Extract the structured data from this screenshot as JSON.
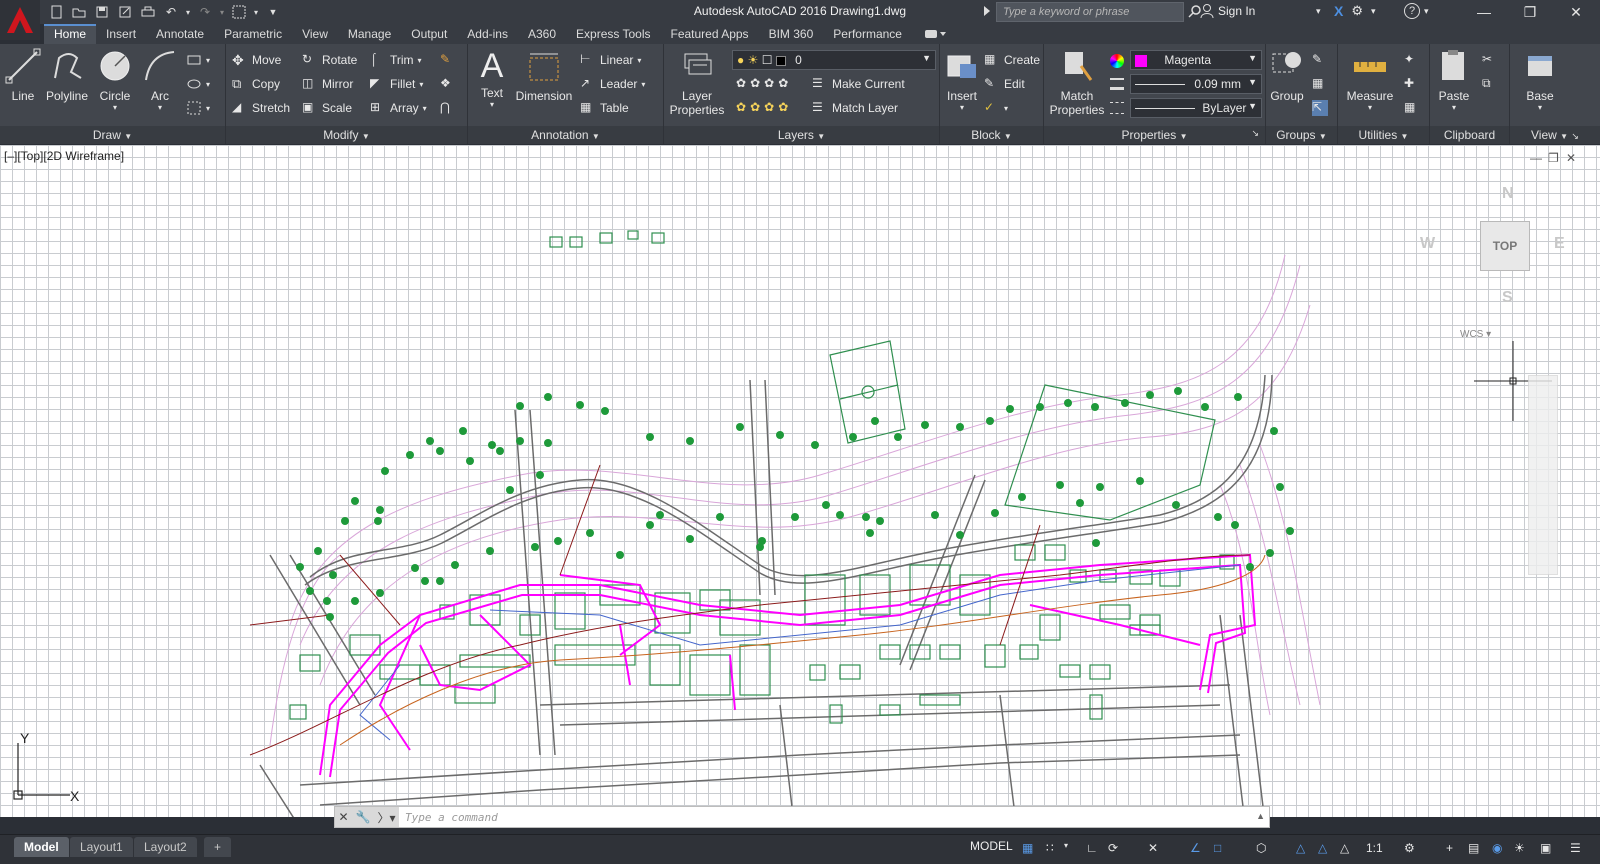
{
  "window": {
    "title": "Autodesk AutoCAD 2016    Drawing1.dwg",
    "search_placeholder": "Type a keyword or phrase",
    "sign_in": "Sign In"
  },
  "ribbon_tabs": [
    "Home",
    "Insert",
    "Annotate",
    "Parametric",
    "View",
    "Manage",
    "Output",
    "Add-ins",
    "A360",
    "Express Tools",
    "Featured Apps",
    "BIM 360",
    "Performance"
  ],
  "panels": {
    "draw": {
      "title": "Draw",
      "line": "Line",
      "polyline": "Polyline",
      "circle": "Circle",
      "arc": "Arc"
    },
    "modify": {
      "title": "Modify",
      "move": "Move",
      "rotate": "Rotate",
      "trim": "Trim",
      "copy": "Copy",
      "mirror": "Mirror",
      "fillet": "Fillet",
      "stretch": "Stretch",
      "scale": "Scale",
      "array": "Array"
    },
    "annotation": {
      "title": "Annotation",
      "text": "Text",
      "dimension": "Dimension",
      "linear": "Linear",
      "leader": "Leader",
      "table": "Table"
    },
    "layers": {
      "title": "Layers",
      "layer_properties_1": "Layer",
      "layer_properties_2": "Properties",
      "current_layer": "0",
      "make_current": "Make Current",
      "match_layer": "Match Layer"
    },
    "block": {
      "title": "Block",
      "insert": "Insert",
      "create": "Create",
      "edit": "Edit"
    },
    "properties": {
      "title": "Properties",
      "match_1": "Match",
      "match_2": "Properties",
      "color": "Magenta",
      "color_hex": "#ff00ff",
      "lineweight": "0.09 mm",
      "linetype": "ByLayer"
    },
    "groups": {
      "title": "Groups",
      "group": "Group"
    },
    "utilities": {
      "title": "Utilities",
      "measure": "Measure"
    },
    "clipboard": {
      "title": "Clipboard",
      "paste": "Paste"
    },
    "view": {
      "title": "View",
      "base": "Base"
    }
  },
  "viewport": {
    "label": "[–][Top][2D Wireframe]",
    "viewcube": {
      "north": "N",
      "south": "S",
      "east": "E",
      "west": "W",
      "face": "TOP",
      "wcs": "WCS"
    },
    "ucs": {
      "x": "X",
      "y": "Y"
    }
  },
  "command_line": {
    "placeholder": "Type a command"
  },
  "layout_tabs": [
    "Model",
    "Layout1",
    "Layout2"
  ],
  "status": {
    "model": "MODEL",
    "scale": "1:1"
  },
  "colors": {
    "magenta": "#ff00ff",
    "green": "#2f8f4f",
    "tree": "#1e9a3a",
    "road": "#6b6b6b",
    "maroon": "#8b1a1a",
    "orange": "#c8641e",
    "contour": "#d9a6d9",
    "blue": "#4466cc"
  }
}
